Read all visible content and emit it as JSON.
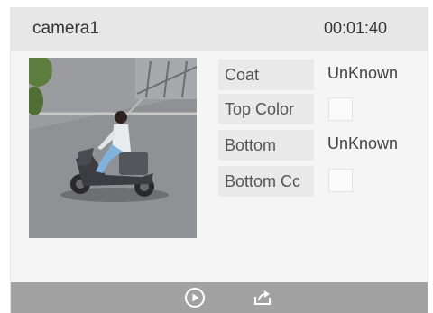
{
  "header": {
    "camera_name": "camera1",
    "time": "00:01:40"
  },
  "thumbnail": {
    "icon": "person-on-scooter-image"
  },
  "attributes": [
    {
      "label": "Coat",
      "value": "UnKnown"
    },
    {
      "label": "Top Color",
      "value": ""
    },
    {
      "label": "Bottom",
      "value": "UnKnown"
    },
    {
      "label": "Bottom Cc",
      "value": ""
    }
  ],
  "footer": {
    "play_icon": "play-circle-icon",
    "export_icon": "export-share-icon"
  }
}
